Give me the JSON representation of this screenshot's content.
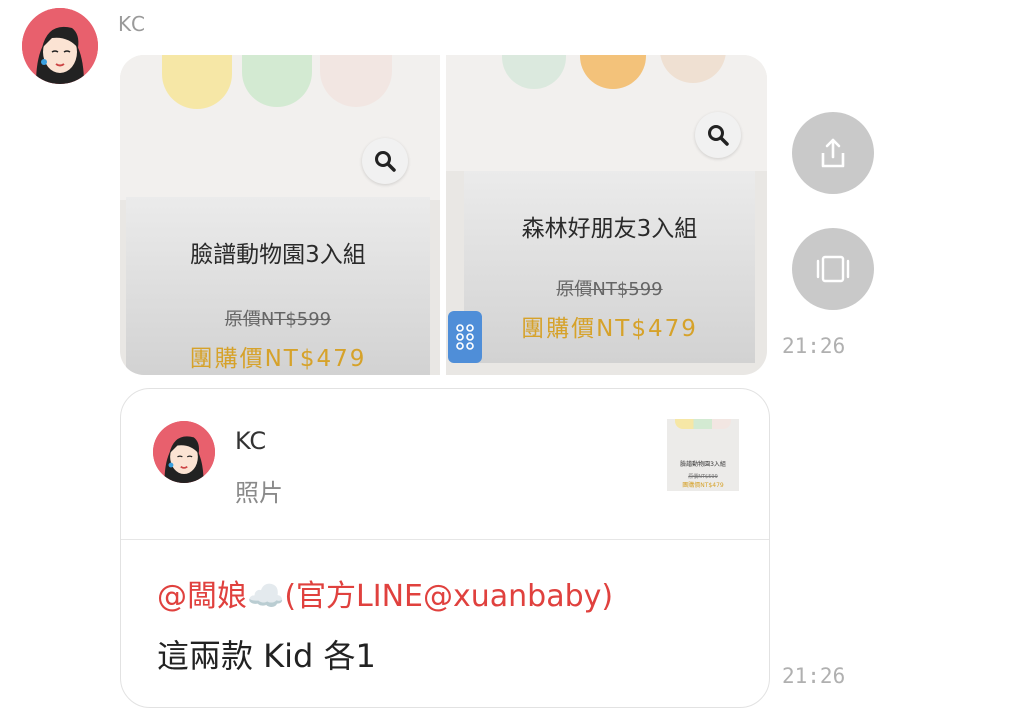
{
  "sender": {
    "name": "KC"
  },
  "products": [
    {
      "title": "臉譜動物園3入組",
      "original_price": "原價NT$599",
      "group_price": "團購價NT$479"
    },
    {
      "title": "森林好朋友3入組",
      "original_price": "原價NT$599",
      "group_price": "團購價NT$479"
    }
  ],
  "image_message": {
    "timestamp": "21:26"
  },
  "quote": {
    "name": "KC",
    "type_label": "照片",
    "thumb_title": "臉譜動物園3入組",
    "thumb_old": "原價NT$599",
    "thumb_new": "團購價NT$479"
  },
  "reply": {
    "mention": "@闆娘☁️(官方LINE@xuanbaby)",
    "text": "這兩款 Kid 各1",
    "timestamp": "21:26"
  },
  "colors": {
    "accent_gold": "#d6a22a",
    "mention_red": "#e0413e",
    "button_grey": "#c9c9c9"
  }
}
